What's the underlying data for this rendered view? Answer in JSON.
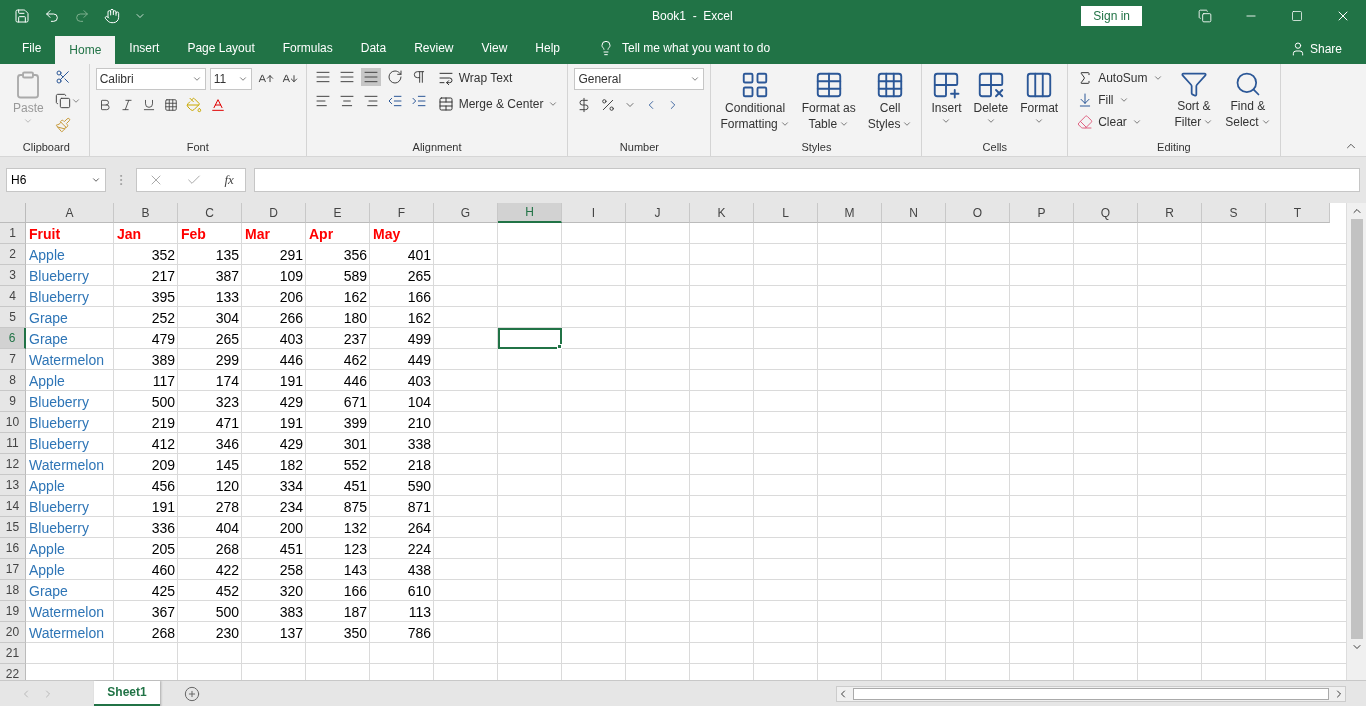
{
  "title_bar": {
    "title": "Book1  -  Excel",
    "sign_in": "Sign in"
  },
  "tabs": [
    {
      "label": "File",
      "selected": false
    },
    {
      "label": "Home",
      "selected": true
    },
    {
      "label": "Insert",
      "selected": false
    },
    {
      "label": "Page Layout",
      "selected": false
    },
    {
      "label": "Formulas",
      "selected": false
    },
    {
      "label": "Data",
      "selected": false
    },
    {
      "label": "Review",
      "selected": false
    },
    {
      "label": "View",
      "selected": false
    },
    {
      "label": "Help",
      "selected": false
    }
  ],
  "tell_me": "Tell me what you want to do",
  "share": "Share",
  "ribbon": {
    "groups": [
      {
        "kind": "clipboard",
        "label": "Clipboard",
        "paste": "Paste"
      },
      {
        "kind": "font",
        "label": "Font",
        "font_name": "Calibri",
        "font_size": "11"
      },
      {
        "kind": "alignment",
        "label": "Alignment",
        "wrap": "Wrap Text",
        "merge": "Merge & Center"
      },
      {
        "kind": "number",
        "label": "Number",
        "format": "General"
      },
      {
        "kind": "styles",
        "label": "Styles",
        "buttons": [
          [
            "Conditional",
            "Formatting"
          ],
          [
            "Format as",
            "Table"
          ],
          [
            "Cell",
            "Styles"
          ]
        ]
      },
      {
        "kind": "cells",
        "label": "Cells",
        "buttons": [
          "Insert",
          "Delete",
          "Format"
        ]
      },
      {
        "kind": "editing",
        "label": "Editing",
        "autosum": "AutoSum",
        "fill": "Fill",
        "clear": "Clear",
        "buttons": [
          [
            "Sort &",
            "Filter"
          ],
          [
            "Find &",
            "Select"
          ]
        ]
      }
    ]
  },
  "formula_bar": {
    "name_box": "H6",
    "fx": "fx"
  },
  "columns": [
    {
      "label": "A",
      "selected": false
    },
    {
      "label": "B",
      "selected": false
    },
    {
      "label": "C",
      "selected": false
    },
    {
      "label": "D",
      "selected": false
    },
    {
      "label": "E",
      "selected": false
    },
    {
      "label": "F",
      "selected": false
    },
    {
      "label": "G",
      "selected": false
    },
    {
      "label": "H",
      "selected": true
    },
    {
      "label": "I",
      "selected": false
    },
    {
      "label": "J",
      "selected": false
    },
    {
      "label": "K",
      "selected": false
    },
    {
      "label": "L",
      "selected": false
    },
    {
      "label": "M",
      "selected": false
    },
    {
      "label": "N",
      "selected": false
    },
    {
      "label": "O",
      "selected": false
    },
    {
      "label": "P",
      "selected": false
    },
    {
      "label": "Q",
      "selected": false
    },
    {
      "label": "R",
      "selected": false
    },
    {
      "label": "S",
      "selected": false
    },
    {
      "label": "T",
      "selected": false
    }
  ],
  "rows": [
    {
      "number": "1",
      "kind": "header",
      "selected": false,
      "cells": [
        "Fruit",
        "Jan",
        "Feb",
        "Mar",
        "Apr",
        "May"
      ]
    },
    {
      "number": "2",
      "kind": "data",
      "selected": false,
      "cells": [
        "Apple",
        "352",
        "135",
        "291",
        "356",
        "401"
      ]
    },
    {
      "number": "3",
      "kind": "data",
      "selected": false,
      "cells": [
        "Blueberry",
        "217",
        "387",
        "109",
        "589",
        "265"
      ]
    },
    {
      "number": "4",
      "kind": "data",
      "selected": false,
      "cells": [
        "Blueberry",
        "395",
        "133",
        "206",
        "162",
        "166"
      ]
    },
    {
      "number": "5",
      "kind": "data",
      "selected": false,
      "cells": [
        "Grape",
        "252",
        "304",
        "266",
        "180",
        "162"
      ]
    },
    {
      "number": "6",
      "kind": "data",
      "selected": true,
      "cells": [
        "Grape",
        "479",
        "265",
        "403",
        "237",
        "499"
      ]
    },
    {
      "number": "7",
      "kind": "data",
      "selected": false,
      "cells": [
        "Watermelon",
        "389",
        "299",
        "446",
        "462",
        "449"
      ]
    },
    {
      "number": "8",
      "kind": "data",
      "selected": false,
      "cells": [
        "Apple",
        "117",
        "174",
        "191",
        "446",
        "403"
      ]
    },
    {
      "number": "9",
      "kind": "data",
      "selected": false,
      "cells": [
        "Blueberry",
        "500",
        "323",
        "429",
        "671",
        "104"
      ]
    },
    {
      "number": "10",
      "kind": "data",
      "selected": false,
      "cells": [
        "Blueberry",
        "219",
        "471",
        "191",
        "399",
        "210"
      ]
    },
    {
      "number": "11",
      "kind": "data",
      "selected": false,
      "cells": [
        "Blueberry",
        "412",
        "346",
        "429",
        "301",
        "338"
      ]
    },
    {
      "number": "12",
      "kind": "data",
      "selected": false,
      "cells": [
        "Watermelon",
        "209",
        "145",
        "182",
        "552",
        "218"
      ]
    },
    {
      "number": "13",
      "kind": "data",
      "selected": false,
      "cells": [
        "Apple",
        "456",
        "120",
        "334",
        "451",
        "590"
      ]
    },
    {
      "number": "14",
      "kind": "data",
      "selected": false,
      "cells": [
        "Blueberry",
        "191",
        "278",
        "234",
        "875",
        "871"
      ]
    },
    {
      "number": "15",
      "kind": "data",
      "selected": false,
      "cells": [
        "Blueberry",
        "336",
        "404",
        "200",
        "132",
        "264"
      ]
    },
    {
      "number": "16",
      "kind": "data",
      "selected": false,
      "cells": [
        "Apple",
        "205",
        "268",
        "451",
        "123",
        "224"
      ]
    },
    {
      "number": "17",
      "kind": "data",
      "selected": false,
      "cells": [
        "Apple",
        "460",
        "422",
        "258",
        "143",
        "438"
      ]
    },
    {
      "number": "18",
      "kind": "data",
      "selected": false,
      "cells": [
        "Grape",
        "425",
        "452",
        "320",
        "166",
        "610"
      ]
    },
    {
      "number": "19",
      "kind": "data",
      "selected": false,
      "cells": [
        "Watermelon",
        "367",
        "500",
        "383",
        "187",
        "113"
      ]
    },
    {
      "number": "20",
      "kind": "data",
      "selected": false,
      "cells": [
        "Watermelon",
        "268",
        "230",
        "137",
        "350",
        "786"
      ]
    },
    {
      "number": "21",
      "selected": false
    },
    {
      "number": "22",
      "selected": false
    }
  ],
  "sheets": [
    {
      "label": "Sheet1",
      "selected": true
    }
  ]
}
